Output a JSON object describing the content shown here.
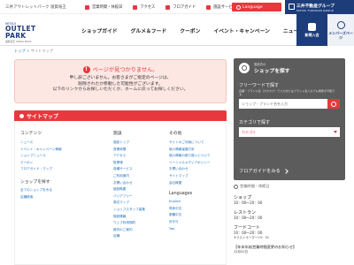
{
  "topbar": {
    "site_name": "三井アウトレットパーク 滋賀竜王",
    "items": [
      {
        "label": "営業時間・休館日",
        "icon": "clock-icon"
      },
      {
        "label": "アクセス",
        "icon": "car-icon"
      },
      {
        "label": "フロアガイド",
        "icon": "map-icon"
      },
      {
        "label": "施設サービス",
        "icon": "info-icon"
      }
    ],
    "language": "Language",
    "group_name": "三井不動産グループ",
    "group_sub": "MITSUI FUDOSAN GROUP"
  },
  "header": {
    "logo_top": "MITSUI",
    "logo_main": "OUTLET PARK",
    "logo_sub": "滋賀竜王 SHIGA RYUO",
    "nav": [
      "ショップガイド",
      "グルメ＆フード",
      "クーポン",
      "イベント・キャンペーン",
      "ニュース"
    ],
    "news_btn": "新規入会",
    "member_btn": "メンバーズページ"
  },
  "breadcrumb": {
    "home": "トップ",
    "sep": ">",
    "current": "サイトマップ"
  },
  "error": {
    "title": "ページが見つかりません。",
    "lines": [
      "申し訳ございません。お客さまがご指定のページは、",
      "削除されたか移動した可能性がございます。",
      "以下のリンクからお探しいただくか、ホームに戻ってお探しください。"
    ]
  },
  "sitemap": {
    "title": "サイトマップ",
    "col1": {
      "title": "コンテンツ",
      "links": [
        "ニュース",
        "イベント・キャンペーン情報",
        "ショップニュース",
        "クーポン",
        "フロアガイド・マップ"
      ],
      "sub_title": "ショップを探す",
      "sub_links": [
        "全てのショップをみる",
        "店舗検索"
      ]
    },
    "col2": {
      "title": "施設",
      "links": [
        "施設トップ",
        "営業時間",
        "アクセス",
        "駐車場",
        "各種サービス",
        "ご利用案内",
        "お問い合わせ",
        "施設概要",
        "バリアフリー",
        "周辺マップ",
        "ショップスタッフ募集",
        "施設情報",
        "ウェブ利用規約",
        "館内のご案内",
        "店舗"
      ]
    },
    "col3": {
      "title": "その他",
      "links": [
        "サイトのご利用について",
        "個人情報保護方針",
        "個人情報の取り扱いについて",
        "ソーシャルメディアポリシー",
        "お問い合わせ",
        "サイトマップ",
        "会社概要"
      ],
      "sub_title": "Languages",
      "sub_links": [
        "English",
        "简体中文",
        "繁體中文",
        "한국어",
        "ไทย"
      ]
    }
  },
  "search": {
    "title_small": "施設内の",
    "title_big": "ショップを探す",
    "freeword_label": "フリーワードで探す",
    "freeword_hint": "店舗・ブランド名（カタカナ）で入力またはブランド名入力でも検索が可能です。",
    "input_placeholder": "ショップ・ブランド名を入力",
    "category_label": "カテゴリで探す",
    "category_value": "カテゴリ",
    "floor_link": "フロアガイドをみる"
  },
  "hours": {
    "head": "営業時間・休館日",
    "items": [
      {
        "name": "ショップ",
        "time": "10：00～20：00",
        "note": ""
      },
      {
        "name": "レストラン",
        "time": "10：00～20：00",
        "note": ""
      },
      {
        "name": "フードコート",
        "time": "10：00～20：00",
        "note": "※ラストオーダー19：30"
      }
    ],
    "notice": "【年末年始営業時間変更のお知らせ】",
    "notice_date": "12月31日"
  }
}
